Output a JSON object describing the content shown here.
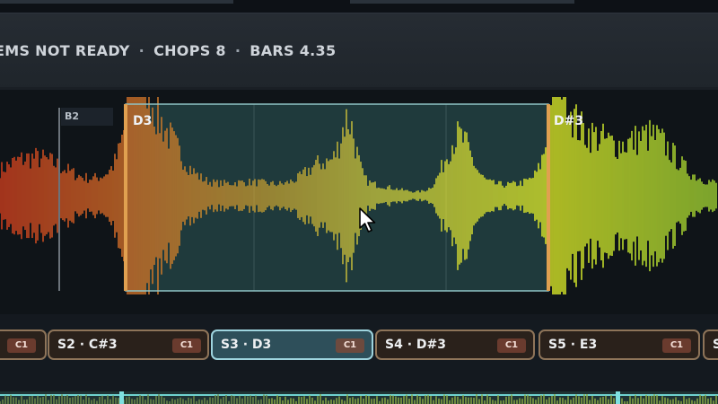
{
  "info": {
    "status": "EMS NOT READY",
    "separator": "·",
    "chops": "CHOPS 8",
    "bars": "BARS 4.35"
  },
  "markers": {
    "b2": "B2",
    "d3": "D3",
    "d_sharp_3": "D#3"
  },
  "slices": [
    {
      "name": "",
      "badge": "C1",
      "active": false
    },
    {
      "name": "S2 · C#3",
      "badge": "C1",
      "active": false
    },
    {
      "name": "S3 · D3",
      "badge": "C1",
      "active": true
    },
    {
      "name": "S4 · D#3",
      "badge": "C1",
      "active": false
    },
    {
      "name": "S5 · E3",
      "badge": "C1",
      "active": false
    },
    {
      "name": "S",
      "badge": "",
      "active": false
    }
  ],
  "colors": {
    "selection_border": "#8fc4c6",
    "selection_fill": "#1f3a3c",
    "slice_border": "#8e7459",
    "slice_active_border": "#9ed4de",
    "marker_orange": "#e0a050"
  }
}
